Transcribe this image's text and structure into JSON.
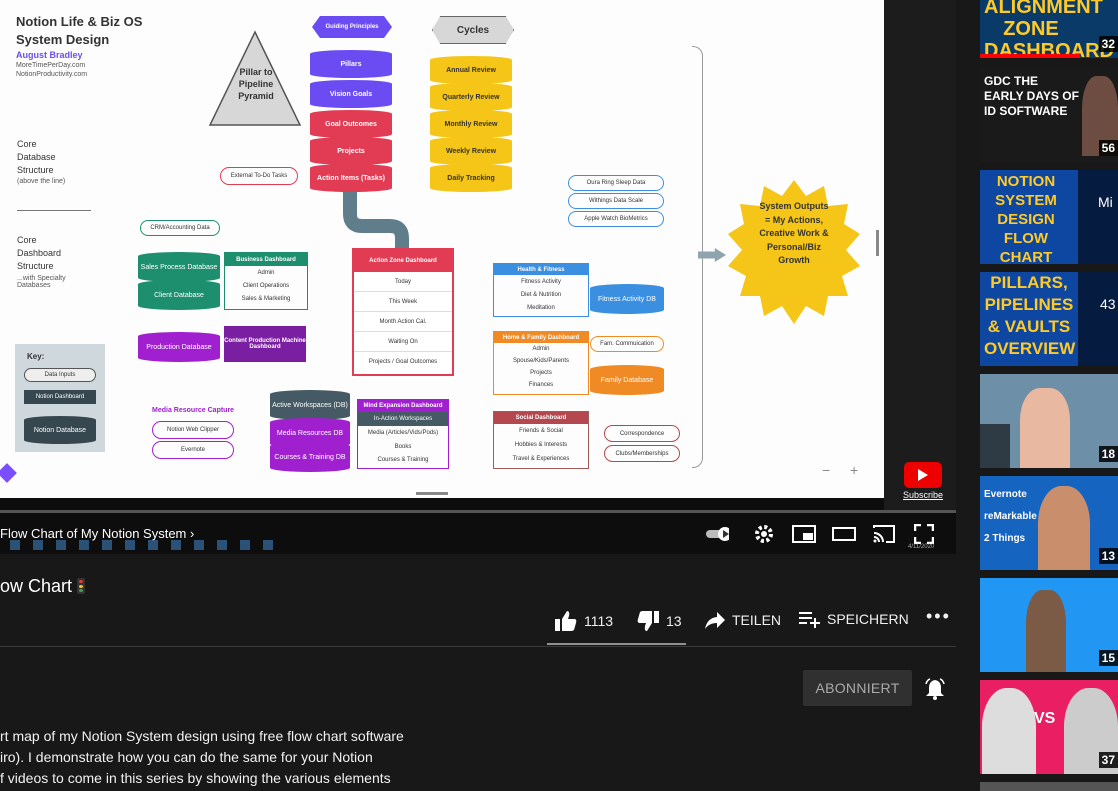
{
  "diagram": {
    "title_line1": "Notion Life & Biz OS",
    "title_line2": "System Design",
    "author": "August Bradley",
    "site1": "MoreTimePerDay.com",
    "site2": "NotionProductivity.com",
    "pyramid": "Pillar to Pipeline Pyramid",
    "core_db_label": "Core Database Structure",
    "core_db_sub": "(above the line)",
    "core_dash_label": "Core Dashboard Structure",
    "core_dash_sub": "...with Specialty Databases",
    "guiding": "Guiding Principles",
    "cycles": "Cycles",
    "pillars": "Pillars",
    "vision": "Vision Goals",
    "goal_outcomes": "Goal Outcomes",
    "projects": "Projects",
    "action_items": "Action Items (Tasks)",
    "external": "External To-Do Tasks",
    "annual": "Annual Review",
    "quarterly": "Quarterly Review",
    "monthly": "Monthly Review",
    "weekly": "Weekly Review",
    "daily": "Daily Tracking",
    "oura": "Oura Ring Sleep Data",
    "withings": "Withings Data Scale",
    "apple": "Apple Watch BioMetrics",
    "crm": "CRM/Accounting Data",
    "sales_db": "Sales Process Database",
    "client_db": "Client Database",
    "biz_dash": "Business Dashboard",
    "biz_items": [
      "Admin",
      "Client Operations",
      "Sales & Marketing"
    ],
    "prod_db": "Production Database",
    "content_dash": "Content Production Machine Dashboard",
    "az_dash": "Action Zone Dashboard",
    "az_items": [
      "Today",
      "This Week",
      "Month Action Cal.",
      "Waiting On",
      "Projects / Goal Outcomes"
    ],
    "health": "Health & Fitness",
    "health_items": [
      "Fitness Activity",
      "Diet & Nutrition",
      "Meditation"
    ],
    "fitness_db": "Fitness Activity DB",
    "home": "Home & Family Dashboard",
    "home_items": [
      "Admin",
      "Spouse/Kids/Parents",
      "Projects",
      "Finances"
    ],
    "fam_comm": "Fam. Commuication",
    "family_db": "Family Database",
    "social": "Social Dashboard",
    "social_items": [
      "Friends & Social",
      "Hobbies & Interests",
      "Travel & Experiences"
    ],
    "correspondence": "Correspondence",
    "clubs": "Clubs/Memberships",
    "mind": "Mind Expansion Dashboard",
    "mind_items": [
      "In-Action Workspaces",
      "Media (Articles/Vids/Pods)",
      "Books",
      "Courses & Training"
    ],
    "active_ws": "Active Workspaces (DB)",
    "media_res": "Media Resources DB",
    "courses_db": "Courses & Training DB",
    "media_capture": "Media Resource Capture",
    "web_clipper": "Notion Web Clipper",
    "evernote": "Evernote",
    "key": "Key:",
    "key_inputs": "Data Inputs",
    "key_dash": "Notion Dashboard",
    "key_db": "Notion Database",
    "outputs": "System Outputs = My Actions, Creative Work & Personal/Biz Growth",
    "zoom_minus": "−",
    "zoom_plus": "+"
  },
  "player": {
    "subscribe_badge": "Subscribe",
    "chapter": "Flow Chart of My Notion System",
    "clock": "4/11/2020"
  },
  "video": {
    "title": "ow Chart",
    "likes": "1113",
    "dislikes": "13",
    "share": "TEILEN",
    "save": "SPEICHERN",
    "subscribe": "ABONNIERT",
    "description": [
      "rt map of my Notion System design using free flow chart software",
      "iro). I demonstrate how you can do the same for your Notion",
      "f videos to come in this series by showing the various elements"
    ]
  },
  "sidebar": {
    "thumbs": [
      {
        "text": "ALIGNMENT ZONE DASHBOARD",
        "duration": "32"
      },
      {
        "text": "GDC THE EARLY DAYS OF ID SOFTWARE",
        "duration": "56"
      },
      {
        "text": "NOTION SYSTEM DESIGN FLOW CHART",
        "duration": "Mi"
      },
      {
        "text": "PILLARS, PIPELINES & VAULTS OVERVIEW",
        "duration": "43"
      },
      {
        "text": "",
        "duration": "18"
      },
      {
        "text": "Evernote reMarkable 2 Things",
        "duration": "13"
      },
      {
        "text": "",
        "duration": "15"
      },
      {
        "text": "VS",
        "duration": "37"
      }
    ]
  },
  "colors": {
    "bg": "#181818",
    "purple": "#6b4cf2",
    "red": "#e23b54",
    "yellow": "#f5c518",
    "teal": "#1e8f6e",
    "blue": "#3b8fe0",
    "orange": "#f08a24",
    "violet": "#a020d0",
    "slate": "#455a64"
  }
}
